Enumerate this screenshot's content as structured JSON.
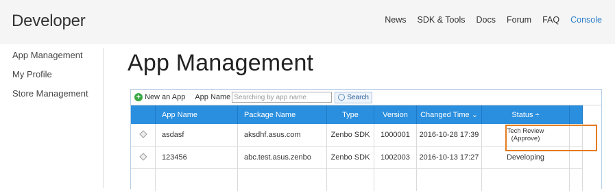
{
  "header": {
    "brand": "Developer",
    "nav": [
      "News",
      "SDK & Tools",
      "Docs",
      "Forum",
      "FAQ",
      "Console"
    ]
  },
  "sidebar": {
    "items": [
      "App Management",
      "My Profile",
      "Store Management"
    ]
  },
  "main": {
    "title": "App Management",
    "toolbar": {
      "new_app": "New an App",
      "field_label": "App Name",
      "search_placeholder": "Searching by app name",
      "search_label": "Search"
    },
    "columns": [
      "App Name",
      "Package Name",
      "Type",
      "Version",
      "Changed Time",
      "Status"
    ],
    "sort_indicators": {
      "changed_time": "⌄",
      "status": "÷"
    },
    "rows": [
      {
        "app_name": "asdasf",
        "package_name": "aksdhf.asus.com",
        "type": "Zenbo SDK",
        "version": "1000001",
        "changed_time": "2016-10-28 17:39",
        "status_line1": "Tech Review",
        "status_line2": "(Approve)"
      },
      {
        "app_name": "123456",
        "package_name": "abc.test.asus.zenbo",
        "type": "Zenbo SDK",
        "version": "1002003",
        "changed_time": "2016-10-13 17:27",
        "status": "Developing"
      }
    ]
  },
  "colors": {
    "header_bg": "#2a8fdf",
    "accent_link": "#2f7fc8",
    "highlight": "#e47b1f"
  }
}
